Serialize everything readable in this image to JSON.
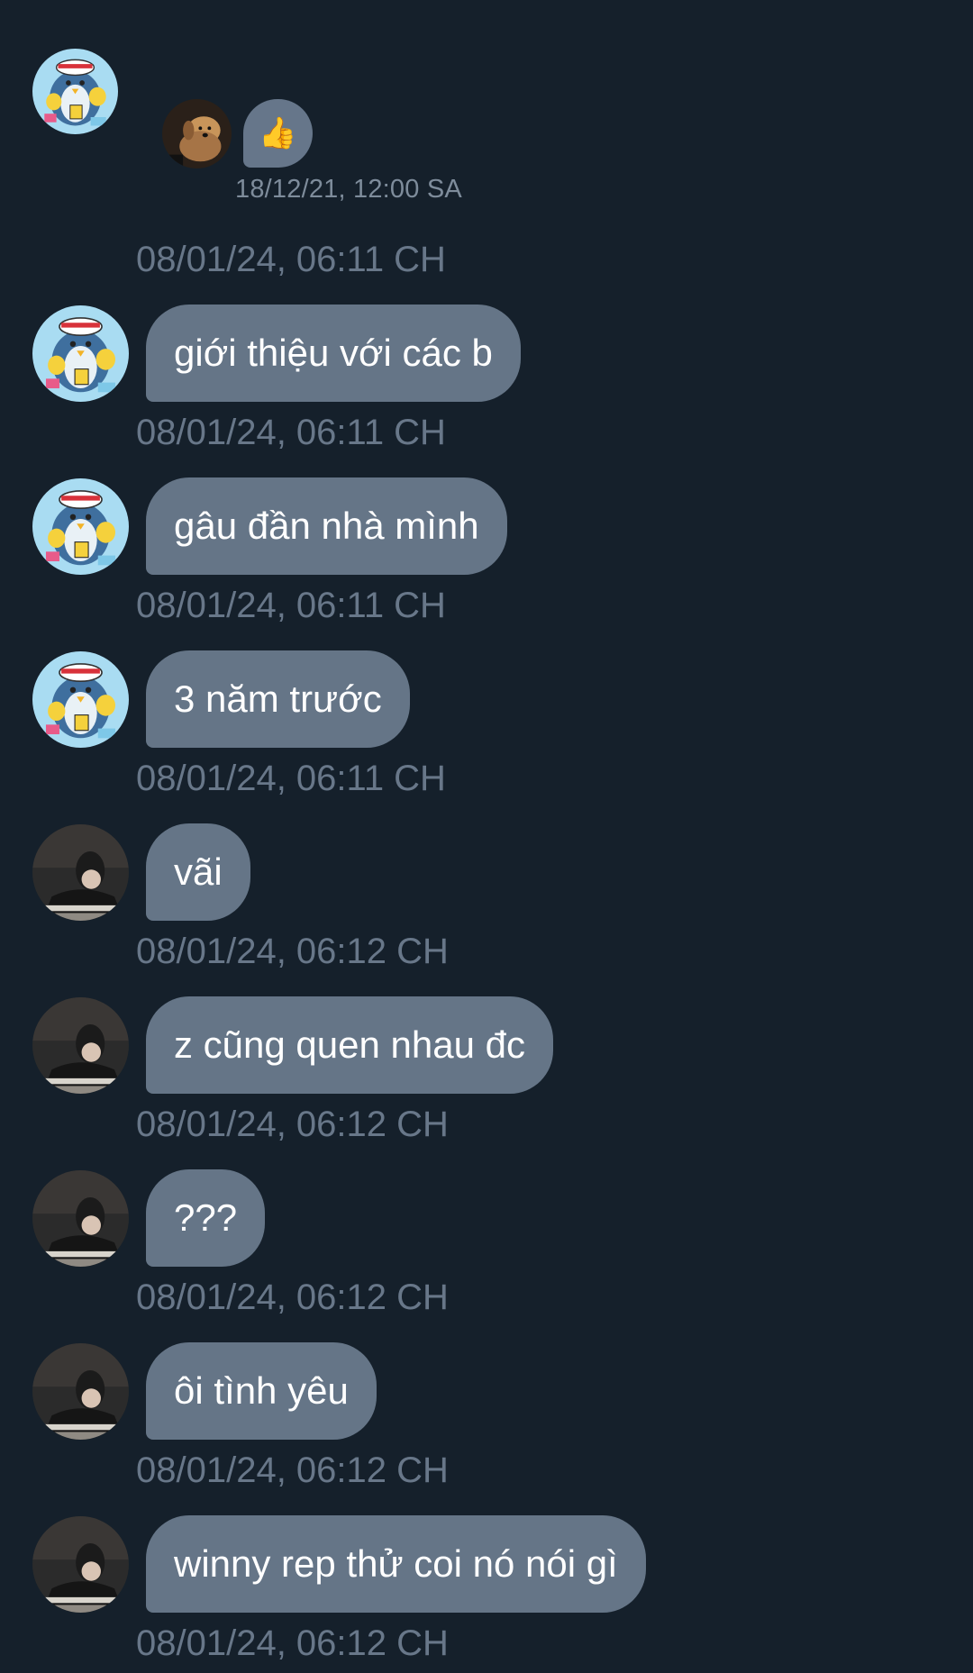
{
  "reply": {
    "emoji": "👍",
    "time": "18/12/21, 12:00 SA"
  },
  "header_timestamp": "08/01/24, 06:11 CH",
  "messages": [
    {
      "text": "giới thiệu với các b",
      "time": "08/01/24, 06:11 CH",
      "avatar": "penguin-avatar"
    },
    {
      "text": "gâu đần nhà mình",
      "time": "08/01/24, 06:11 CH",
      "avatar": "penguin-avatar"
    },
    {
      "text": "3 năm trước",
      "time": "08/01/24, 06:11 CH",
      "avatar": "penguin-avatar"
    },
    {
      "text": "vãi",
      "time": "08/01/24, 06:12 CH",
      "avatar": "person-avatar"
    },
    {
      "text": "z cũng quen nhau đc",
      "time": "08/01/24, 06:12 CH",
      "avatar": "person-avatar"
    },
    {
      "text": "???",
      "time": "08/01/24, 06:12 CH",
      "avatar": "person-avatar"
    },
    {
      "text": "ôi tình yêu",
      "time": "08/01/24, 06:12 CH",
      "avatar": "person-avatar"
    },
    {
      "text": "winny rep thử coi nó nói gì",
      "time": "08/01/24, 06:12 CH",
      "avatar": "person-avatar"
    }
  ],
  "colors": {
    "background": "#15202b",
    "bubble": "#657587",
    "timestamp": "#687789"
  }
}
